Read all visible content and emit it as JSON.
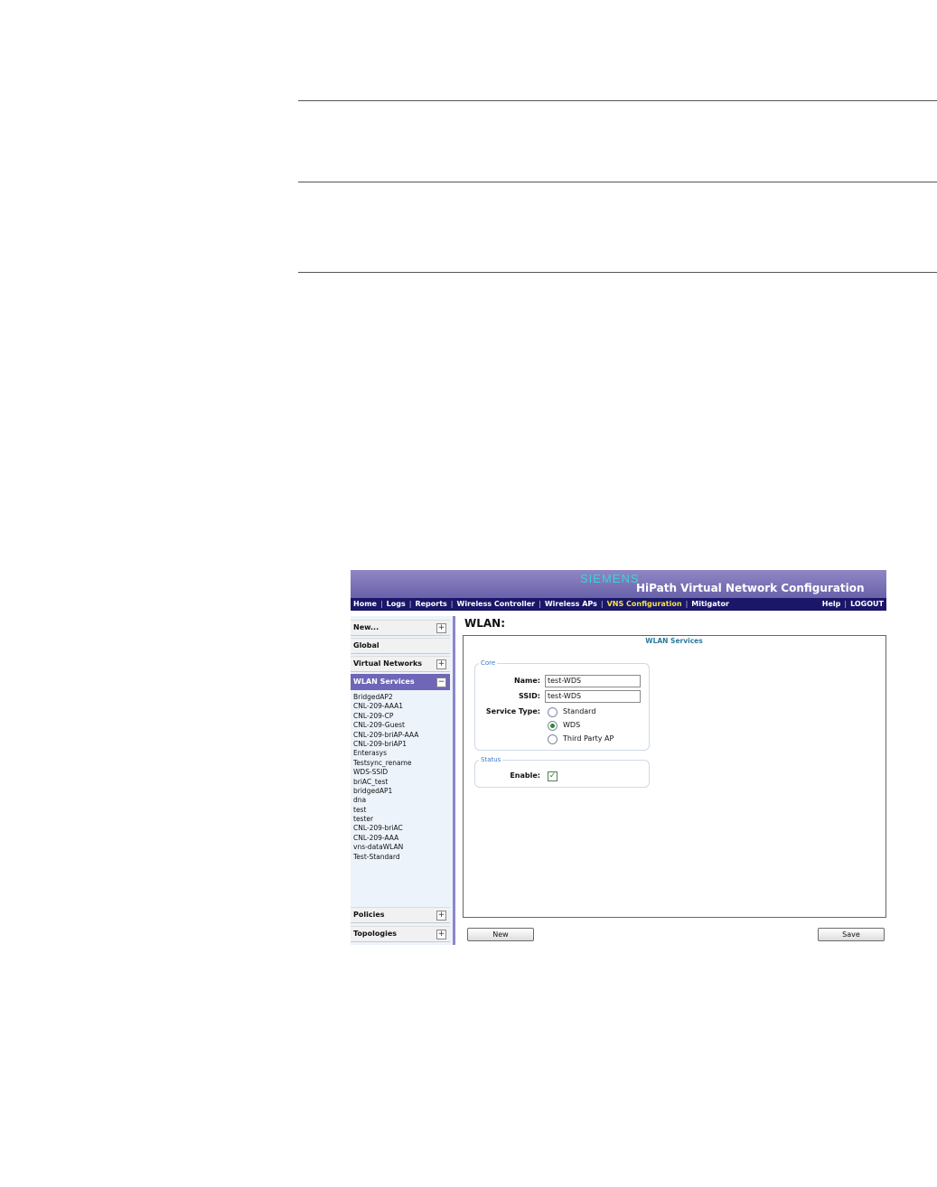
{
  "banner": {
    "brand": "SIEMENS",
    "title": "HiPath Virtual Network Configuration"
  },
  "nav": {
    "items": [
      "Home",
      "Logs",
      "Reports",
      "Wireless Controller",
      "Wireless APs",
      "VNS Configuration",
      "Mitigator"
    ],
    "active": "VNS Configuration",
    "right": [
      "Help",
      "LOGOUT"
    ]
  },
  "sidebar": {
    "new": {
      "label": "New...",
      "toggle": "+"
    },
    "global": {
      "label": "Global"
    },
    "virtual_networks": {
      "label": "Virtual Networks",
      "toggle": "+"
    },
    "wlan_services": {
      "label": "WLAN Services",
      "toggle": "−"
    },
    "items": [
      "BridgedAP2",
      "CNL-209-AAA1",
      "CNL-209-CP",
      "CNL-209-Guest",
      "CNL-209-briAP-AAA",
      "CNL-209-briAP1",
      "Enterasys",
      "Testsync_rename",
      "WDS-SSID",
      "briAC_test",
      "bridgedAP1",
      "dna",
      "test",
      "tester",
      "CNL-209-briAC",
      "CNL-209-AAA",
      "vns-dataWLAN",
      "Test-Standard"
    ],
    "policies": {
      "label": "Policies",
      "toggle": "+"
    },
    "topologies": {
      "label": "Topologies",
      "toggle": "+"
    }
  },
  "main": {
    "title": "WLAN:",
    "tab": "WLAN Services",
    "core": {
      "legend": "Core",
      "name_label": "Name:",
      "name_value": "test-WDS",
      "ssid_label": "SSID:",
      "ssid_value": "test-WDS",
      "service_type_label": "Service Type:",
      "options": [
        "Standard",
        "WDS",
        "Third Party AP"
      ],
      "selected": "WDS"
    },
    "status": {
      "legend": "Status",
      "enable_label": "Enable:",
      "enabled": true,
      "check_glyph": "✓"
    }
  },
  "buttons": {
    "new": "New",
    "save": "Save"
  }
}
